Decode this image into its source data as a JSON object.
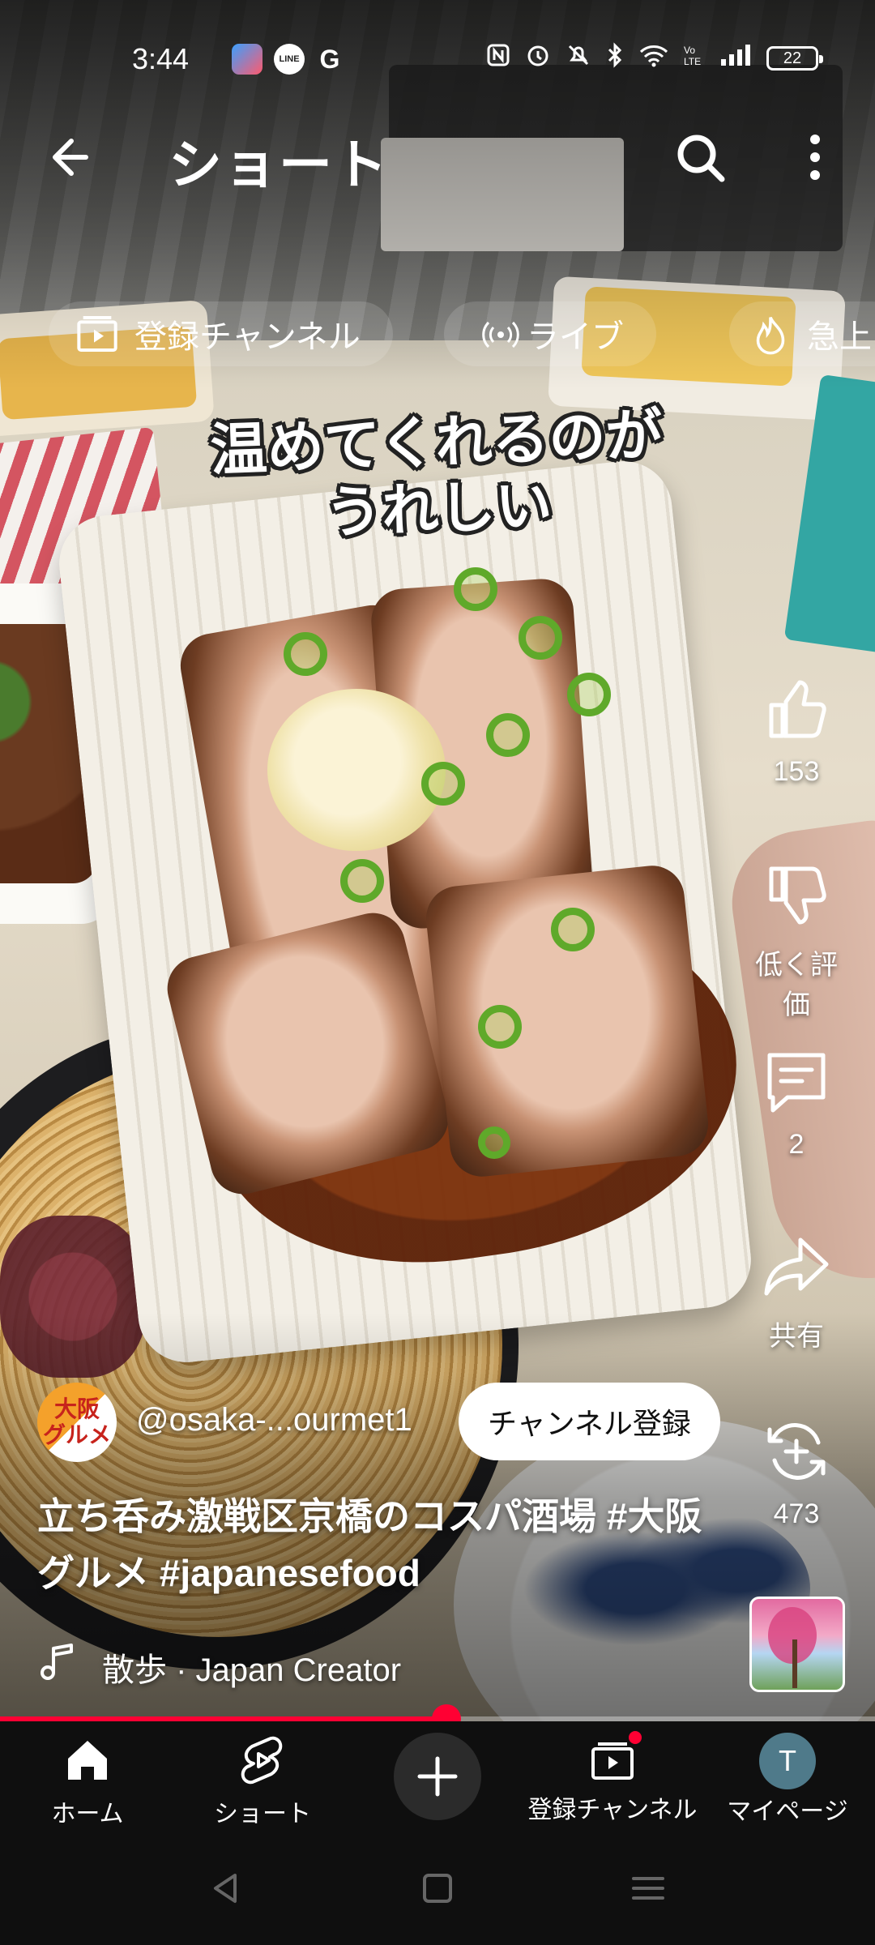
{
  "status_bar": {
    "time": "3:44",
    "app_icons": [
      "map-app-icon",
      "line-app-icon",
      "google-app-icon"
    ],
    "line_label": "LINE",
    "google_label": "G",
    "battery": "22",
    "icons": [
      "nfc-icon",
      "alarm-icon",
      "mute-icon",
      "bluetooth-icon",
      "wifi-icon",
      "volte-icon",
      "signal-icon"
    ]
  },
  "header": {
    "title": "ショート"
  },
  "chips": [
    {
      "label": "登録チャンネル",
      "icon": "subscriptions-icon"
    },
    {
      "label": "ライブ",
      "icon": "live-icon"
    },
    {
      "label": "急上",
      "icon": "trending-icon"
    }
  ],
  "video": {
    "caption_line1": "温めてくれるのが",
    "caption_line2": "うれしい"
  },
  "actions": {
    "like_count": "153",
    "dislike_label": "低く評価",
    "comment_count": "2",
    "share_label": "共有",
    "remix_count": "473"
  },
  "channel": {
    "avatar_text_line1": "大阪",
    "avatar_text_line2": "グルメ",
    "handle": "@osaka-...ourmet1",
    "subscribe_label": "チャンネル登録"
  },
  "title": "立ち呑み激戦区京橋のコスパ酒場 #大阪グルメ #japanesefood",
  "music": {
    "text": "散歩 · Japan Creator"
  },
  "progress": {
    "fraction": 0.51
  },
  "bottom_nav": {
    "home": "ホーム",
    "shorts": "ショート",
    "subscriptions": "登録チャンネル",
    "me": "マイページ",
    "me_initial": "T"
  },
  "colors": {
    "accent": "#ff0033",
    "nav_background": "#0f0f0f"
  }
}
